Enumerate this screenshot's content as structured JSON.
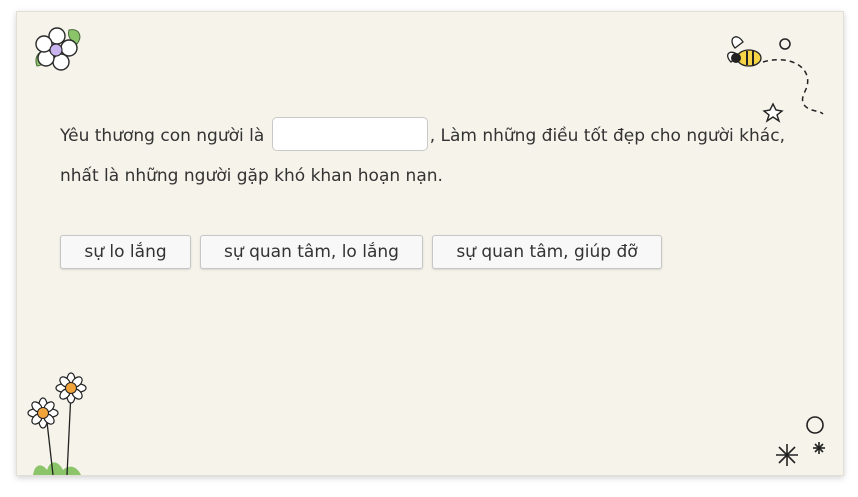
{
  "question": {
    "text_before": "Yêu thương con người là",
    "text_after": ", Làm những điều tốt đẹp cho người khác,",
    "text_line2": "nhất là những người gặp khó khan hoạn nạn.",
    "blank_value": ""
  },
  "options": [
    {
      "label": "sự lo lắng"
    },
    {
      "label": "sự quan tâm, lo lắng"
    },
    {
      "label": "sự quan tâm, giúp đỡ"
    }
  ],
  "colors": {
    "card_background": "#f5f3ea",
    "text": "#333333",
    "button_background": "#f8f8f8",
    "button_border": "#c6c6c6",
    "flower_center": "#f0a33a",
    "leaf": "#8cc46a"
  },
  "decorations": [
    "flower-icon",
    "bee-icon",
    "star-icon",
    "daisy-flowers-icon",
    "sparkle-icon"
  ]
}
